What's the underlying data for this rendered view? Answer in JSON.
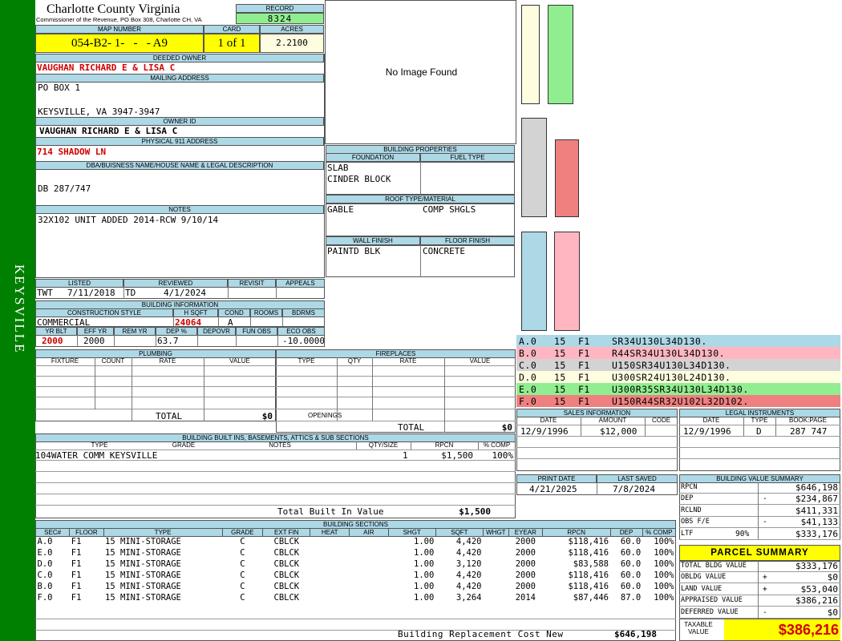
{
  "sidebar": {
    "text": "KEYSVILLE",
    "color": "#008000"
  },
  "county": {
    "name": "Charlotte County Virginia",
    "address": "Commissioner of the Revenue, PO Box 308, Charlotte CH, VA"
  },
  "record": {
    "label": "RECORD",
    "value": "8324"
  },
  "map": {
    "label": "MAP NUMBER",
    "value": "054-B2- 1-   -   - A9"
  },
  "card": {
    "label": "CARD",
    "value": "1 of 1"
  },
  "acres": {
    "label": "ACRES",
    "value": "2.2100"
  },
  "deeded_owner": {
    "label": "DEEDED OWNER",
    "value": "VAUGHAN RICHARD E & LISA C"
  },
  "mailing": {
    "label": "MAILING ADDRESS",
    "line1": "PO BOX 1",
    "line2": "KEYSVILLE, VA 3947-3947"
  },
  "owner_id": {
    "label": "OWNER ID",
    "value": "VAUGHAN RICHARD E & LISA C"
  },
  "physical": {
    "label": "PHYSICAL 911 ADDRESS",
    "value": "714 SHADOW LN"
  },
  "legal": {
    "label": "DBA/BUISNESS NAME/HOUSE NAME & LEGAL DESCRIPTION",
    "value": "DB 287/747"
  },
  "notes": {
    "label": "NOTES",
    "value": "32X102 UNIT ADDED 2014-RCW 9/10/14"
  },
  "photo": {
    "text": "No Image Found"
  },
  "building_properties": {
    "label": "BUILDING PROPERTIES",
    "foundation_label": "FOUNDATION",
    "foundation_1": "SLAB",
    "foundation_2": "CINDER BLOCK",
    "fuel_label": "FUEL TYPE",
    "fuel": "",
    "roof_label": "ROOF TYPE/MATERIAL",
    "roof_type": "GABLE",
    "roof_material": "COMP SHGLS",
    "wall_label": "WALL FINISH",
    "wall": "PAINTD BLK",
    "floor_label": "FLOOR FINISH",
    "floor": "CONCRETE"
  },
  "review": {
    "listed_label": "LISTED",
    "listed_by": "TWT",
    "listed_date": "7/11/2018",
    "reviewed_label": "REVIEWED",
    "reviewed_by": "TD",
    "reviewed_date": "4/1/2024",
    "revisit_label": "REVISIT",
    "appeals_label": "APPEALS"
  },
  "building_info": {
    "label": "BUILDING INFORMATION",
    "style_label": "CONSTRUCTION STYLE",
    "style": "COMMERCIAL",
    "hsqft_label": "H SQFT",
    "hsqft": "24064",
    "cond_label": "COND",
    "cond": "A",
    "rooms_label": "ROOMS",
    "bdrms_label": "BDRMS",
    "yrblt_label": "YR BLT",
    "yrblt": "2000",
    "effyr_label": "EFF YR",
    "effyr": "2000",
    "remyr_label": "REM YR",
    "dep_label": "DEP %",
    "dep": "63.7",
    "depovr_label": "DEPOVR",
    "funobs_label": "FUN OBS",
    "ecoobs_label": "ECO OBS",
    "ecoobs": "-10.0000"
  },
  "plumbing": {
    "label": "PLUMBING",
    "cols": [
      "FIXTURE",
      "COUNT",
      "RATE",
      "VALUE"
    ],
    "total_label": "TOTAL",
    "total": "$0"
  },
  "fireplaces": {
    "label": "FIREPLACES",
    "cols": [
      "TYPE",
      "QTY",
      "RATE",
      "VALUE"
    ],
    "openings_label": "OPENINGS",
    "total_label": "TOTAL",
    "total": "$0"
  },
  "builtins": {
    "label": "BUILDING BUILT INS, BASEMENTS, ATTICS & SUB SECTIONS",
    "cols": [
      "TYPE",
      "GRADE",
      "NOTES",
      "QTY/SIZE",
      "RPCN",
      "% COMP"
    ],
    "rows": [
      {
        "type": "104WATER COMM KEYSVILLE",
        "grade": "",
        "notes": "",
        "qty": "1",
        "rpcn": "$1,500",
        "comp": "100%"
      }
    ],
    "total_label": "Total Built In Value",
    "total": "$1,500"
  },
  "sections": {
    "label": "BUILDING SECTIONS",
    "cols": [
      "SEC#",
      "FLOOR",
      "TYPE",
      "GRADE",
      "EXT FIN",
      "HEAT",
      "AIR",
      "SHGT",
      "SQFT",
      "WHGT",
      "EYEAR",
      "RPCN",
      "DEP",
      "% COMP"
    ],
    "rows": [
      {
        "sec": "A.0",
        "floor": "F1",
        "type": "15 MINI-STORAGE",
        "grade": "C",
        "ext": "CBLCK",
        "shgt": "1.00",
        "sqft": "4,420",
        "eyear": "2000",
        "rpcn": "$118,416",
        "dep": "60.0",
        "comp": "100%"
      },
      {
        "sec": "E.0",
        "floor": "F1",
        "type": "15 MINI-STORAGE",
        "grade": "C",
        "ext": "CBLCK",
        "shgt": "1.00",
        "sqft": "4,420",
        "eyear": "2000",
        "rpcn": "$118,416",
        "dep": "60.0",
        "comp": "100%"
      },
      {
        "sec": "D.0",
        "floor": "F1",
        "type": "15 MINI-STORAGE",
        "grade": "C",
        "ext": "CBLCK",
        "shgt": "1.00",
        "sqft": "3,120",
        "eyear": "2000",
        "rpcn": "$83,588",
        "dep": "60.0",
        "comp": "100%"
      },
      {
        "sec": "C.0",
        "floor": "F1",
        "type": "15 MINI-STORAGE",
        "grade": "C",
        "ext": "CBLCK",
        "shgt": "1.00",
        "sqft": "4,420",
        "eyear": "2000",
        "rpcn": "$118,416",
        "dep": "60.0",
        "comp": "100%"
      },
      {
        "sec": "B.0",
        "floor": "F1",
        "type": "15 MINI-STORAGE",
        "grade": "C",
        "ext": "CBLCK",
        "shgt": "1.00",
        "sqft": "4,420",
        "eyear": "2000",
        "rpcn": "$118,416",
        "dep": "60.0",
        "comp": "100%"
      },
      {
        "sec": "F.0",
        "floor": "F1",
        "type": "15 MINI-STORAGE",
        "grade": "C",
        "ext": "CBLCK",
        "shgt": "1.00",
        "sqft": "3,264",
        "eyear": "2014",
        "rpcn": "$87,446",
        "dep": "87.0",
        "comp": "100%"
      }
    ],
    "replacement_label": "Building Replacement Cost New",
    "replacement": "$646,198"
  },
  "segments": [
    {
      "sec": "A.0",
      "n": "15",
      "f": "F1",
      "desc": "SR34U130L34D130.",
      "color": "#add8e6"
    },
    {
      "sec": "B.0",
      "n": "15",
      "f": "F1",
      "desc": "R44SR34U130L34D130.",
      "color": "#ffb6c1"
    },
    {
      "sec": "C.0",
      "n": "15",
      "f": "F1",
      "desc": "U150SR34U130L34D130.",
      "color": "#d3d3d3"
    },
    {
      "sec": "D.0",
      "n": "15",
      "f": "F1",
      "desc": "U300SR24U130L24D130.",
      "color": "#fffde0"
    },
    {
      "sec": "E.0",
      "n": "15",
      "f": "F1",
      "desc": "U300R35SR34U130L34D130.",
      "color": "#90ee90"
    },
    {
      "sec": "F.0",
      "n": "15",
      "f": "F1",
      "desc": "U150R44SR32U102L32D102.",
      "color": "#f08080"
    }
  ],
  "sales": {
    "label": "SALES INFORMATION",
    "cols": [
      "DATE",
      "AMOUNT",
      "CODE"
    ],
    "rows": [
      {
        "date": "12/9/1996",
        "amount": "$12,000",
        "code": ""
      }
    ]
  },
  "instruments": {
    "label": "LEGAL INSTRUMENTS",
    "cols": [
      "DATE",
      "TYPE",
      "BOOK:PAGE"
    ],
    "rows": [
      {
        "date": "12/9/1996",
        "type": "D",
        "book": "287 747"
      }
    ]
  },
  "dates": {
    "print_label": "PRINT DATE",
    "print": "4/21/2025",
    "saved_label": "LAST SAVED",
    "saved": "7/8/2024"
  },
  "value_summary": {
    "label": "BUILDING VALUE SUMMARY",
    "rows": [
      {
        "label": "RPCN",
        "sign": "",
        "value": "$646,198"
      },
      {
        "label": "DEP",
        "sign": "-",
        "value": "$234,867"
      },
      {
        "label": "RCLND",
        "sign": "",
        "value": "$411,331"
      },
      {
        "label": "OBS F/E",
        "sign": "-",
        "value": "$41,133"
      },
      {
        "label": "LTF",
        "pct": "90%",
        "sign": "",
        "value": "$333,176"
      }
    ]
  },
  "parcel": {
    "label": "PARCEL SUMMARY",
    "rows": [
      {
        "label": "TOTAL BLDG VALUE",
        "sign": "",
        "value": "$333,176"
      },
      {
        "label": "OBLDG VALUE",
        "sign": "+",
        "value": "$0"
      },
      {
        "label": "LAND VALUE",
        "sign": "+",
        "value": "$53,040"
      },
      {
        "label": "APPRAISED VALUE",
        "sign": "",
        "value": "$386,216"
      },
      {
        "label": "DEFERRED VALUE",
        "sign": "-",
        "value": "$0"
      }
    ],
    "taxable_label_1": "TAXABLE",
    "taxable_label_2": "VALUE",
    "taxable": "$386,216"
  }
}
